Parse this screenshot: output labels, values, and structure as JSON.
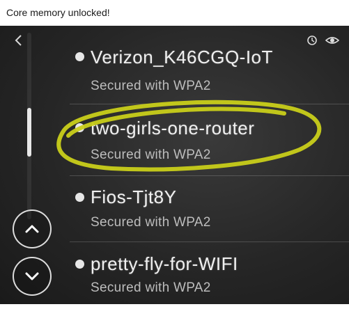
{
  "post": {
    "caption": "Core memory unlocked!"
  },
  "screen": {
    "icons": [
      "chevron-left-icon",
      "refresh-icon",
      "eye-icon",
      "chevron-up-icon",
      "chevron-down-icon"
    ],
    "networks": [
      {
        "name": "Verizon_K46CGQ-IoT",
        "status": "Secured with WPA2"
      },
      {
        "name": "two-girls-one-router",
        "status": "Secured with WPA2"
      },
      {
        "name": "Fios-Tjt8Y",
        "status": "Secured with WPA2"
      },
      {
        "name": "pretty-fly-for-WIFI",
        "status": "Secured with WPA2"
      }
    ],
    "annotation_color": "#c9cf1a"
  }
}
